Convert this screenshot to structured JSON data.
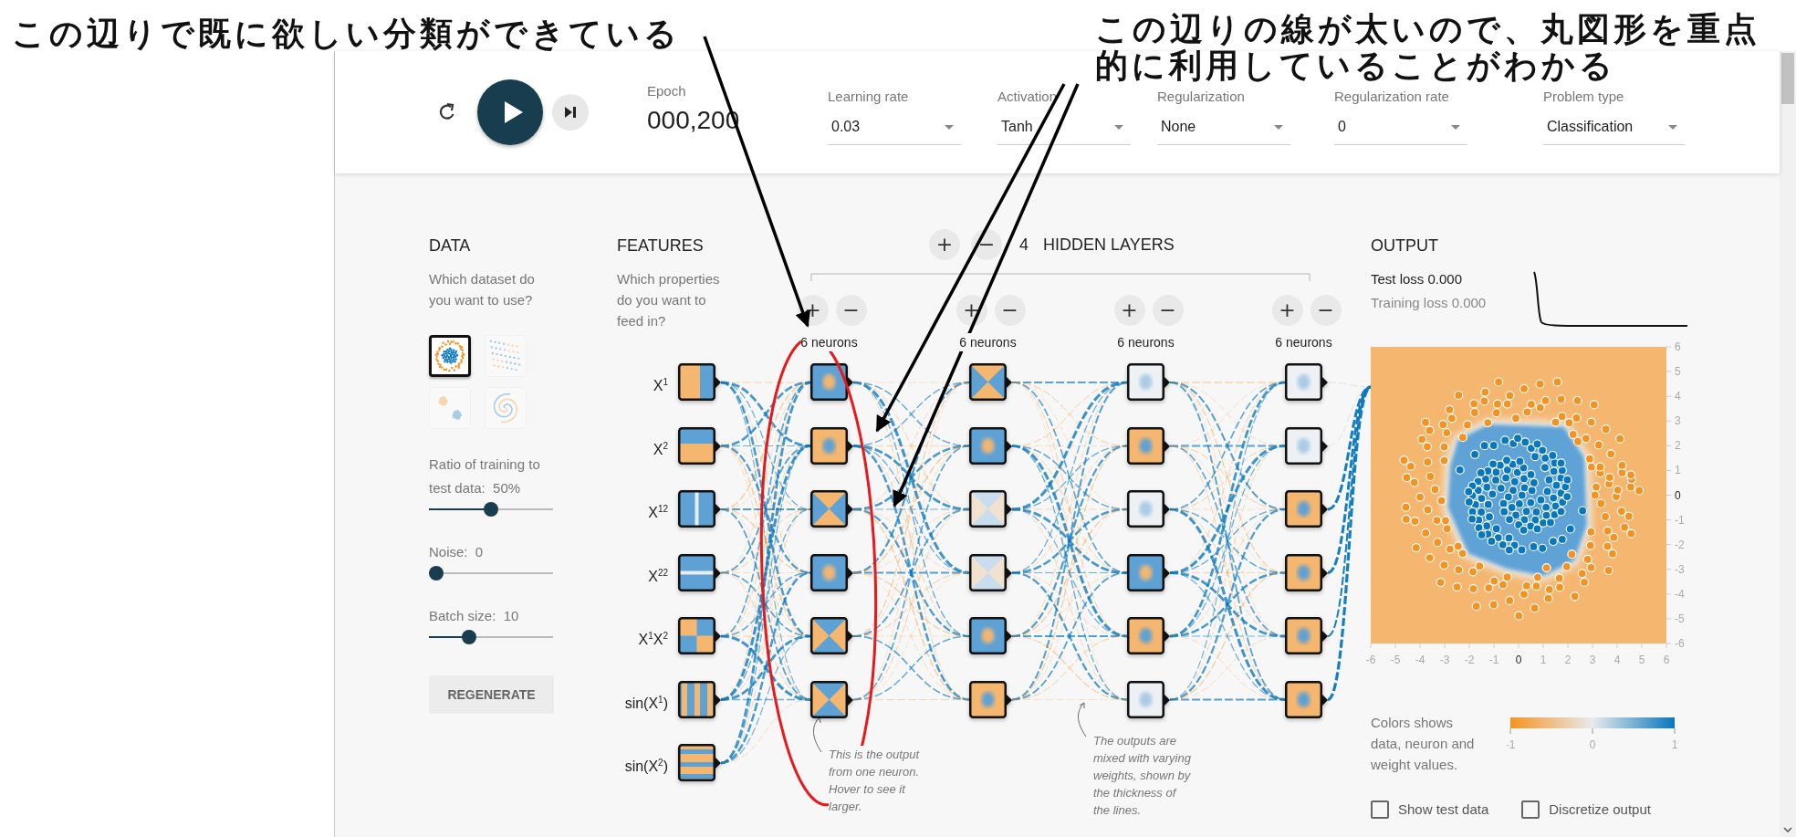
{
  "annotations": [
    {
      "text": "この辺りで既に欲しい分類ができている"
    },
    {
      "text": "この辺りの線が太いので、丸図形を重点的に利用していることがわかる"
    }
  ],
  "epoch": {
    "label": "Epoch",
    "value": "000,200"
  },
  "dropdowns": [
    {
      "label": "Learning rate",
      "value": "0.03"
    },
    {
      "label": "Activation",
      "value": "Tanh"
    },
    {
      "label": "Regularization",
      "value": "None"
    },
    {
      "label": "Regularization rate",
      "value": "0"
    },
    {
      "label": "Problem type",
      "value": "Classification"
    }
  ],
  "data": {
    "title": "DATA",
    "prompt": "Which dataset do you want to use?",
    "datasets": [
      {
        "kind": "circle",
        "selected": true
      },
      {
        "kind": "xor",
        "selected": false
      },
      {
        "kind": "gauss",
        "selected": false
      },
      {
        "kind": "spiral",
        "selected": false
      }
    ],
    "sliders": [
      {
        "label": "Ratio of training to test data:",
        "reading": "50%",
        "level": 0.5
      },
      {
        "label": "Noise:",
        "reading": "0",
        "level": 0
      },
      {
        "label": "Batch size:",
        "reading": "10",
        "level": 0.3
      }
    ],
    "regenerate": "REGENERATE"
  },
  "features": {
    "title": "FEATURES",
    "prompt": "Which properties do you want to feed in?",
    "items": [
      {
        "label": "X$^{1}$",
        "kind": "vsplit"
      },
      {
        "label": "X$^{2}$",
        "kind": "hsplit"
      },
      {
        "label": "X$^{12}$",
        "kind": "vline"
      },
      {
        "label": "X$^{22}$",
        "kind": "hline"
      },
      {
        "label": "X$^{1}$X$^{2}$",
        "kind": "quad"
      },
      {
        "label": "sin(X$^{1}$)",
        "kind": "vwaves"
      },
      {
        "label": "sin(X$^{2}$)",
        "kind": "hwaves"
      }
    ]
  },
  "hidden": {
    "add": "+",
    "remove": "−",
    "count": "4",
    "title": "HIDDEN LAYERS",
    "layers": [
      {
        "add": "+",
        "remove": "−",
        "caption": "6 neurons",
        "neurons": [
          {
            "kind": "blue-dot"
          },
          {
            "kind": "orange-dot"
          },
          {
            "kind": "blue-vtie"
          },
          {
            "kind": "blue-dot"
          },
          {
            "kind": "blue-htie"
          },
          {
            "kind": "orange-vtie"
          }
        ]
      },
      {
        "add": "+",
        "remove": "−",
        "caption": "6 neurons",
        "neurons": [
          {
            "kind": "blue-vtie"
          },
          {
            "kind": "blue-dot"
          },
          {
            "kind": "pale-htie"
          },
          {
            "kind": "pale-htie"
          },
          {
            "kind": "blue-dot"
          },
          {
            "kind": "orange-dot"
          }
        ]
      },
      {
        "add": "+",
        "remove": "−",
        "caption": "6 neurons",
        "neurons": [
          {
            "kind": "pale-dot"
          },
          {
            "kind": "orange-dot"
          },
          {
            "kind": "pale-dot"
          },
          {
            "kind": "blue-dot"
          },
          {
            "kind": "orange-dot"
          },
          {
            "kind": "pale-dot"
          }
        ]
      },
      {
        "add": "+",
        "remove": "−",
        "caption": "6 neurons",
        "neurons": [
          {
            "kind": "pale-dot"
          },
          {
            "kind": "pale-dot"
          },
          {
            "kind": "orange-dot"
          },
          {
            "kind": "orange-dot"
          },
          {
            "kind": "orange-dot"
          },
          {
            "kind": "orange-dot"
          }
        ]
      }
    ]
  },
  "notes": [
    "This is the output from one neuron. Hover to see it larger.",
    "The outputs are mixed with varying weights, shown by the thickness of the lines."
  ],
  "output": {
    "title": "OUTPUT",
    "test_loss": "Test loss 0.000",
    "training_loss": "Training loss 0.000",
    "chart_data": {
      "type": "scatter",
      "xlim": [
        -6,
        6
      ],
      "ylim": [
        -6,
        6
      ],
      "xticks": [
        -6,
        -5,
        -4,
        -3,
        -2,
        -1,
        0,
        1,
        2,
        3,
        4,
        5,
        6
      ],
      "yticks": [
        -6,
        -5,
        -4,
        -3,
        -2,
        -1,
        0,
        1,
        2,
        3,
        4,
        5,
        6
      ]
    },
    "legend": {
      "text": "Colors shows data, neuron and weight values.",
      "ticks": [
        "-1",
        "0",
        "1"
      ]
    },
    "checkboxes": [
      {
        "label": "Show test data",
        "checked": false
      },
      {
        "label": "Discretize output",
        "checked": false
      }
    ]
  }
}
